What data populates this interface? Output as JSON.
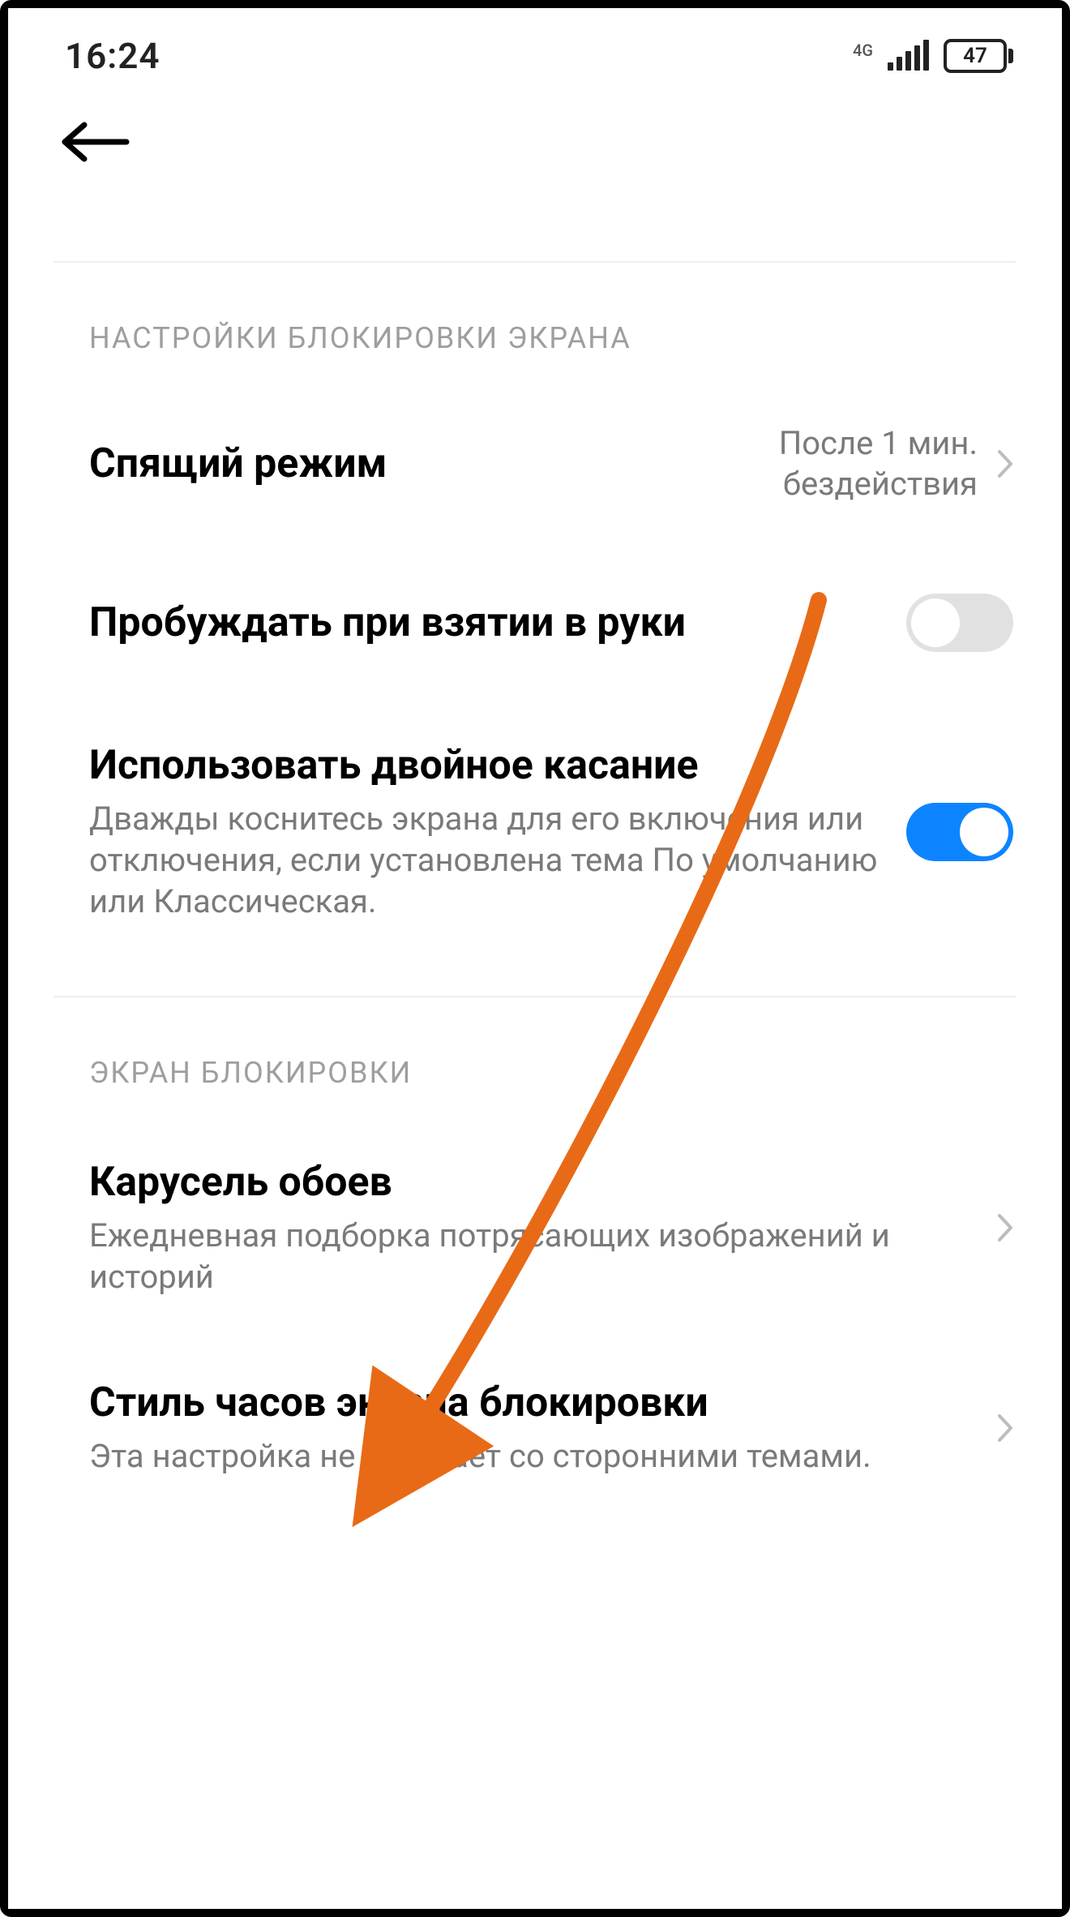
{
  "status": {
    "time": "16:24",
    "network_label": "4G",
    "battery_percent": "47"
  },
  "section1": {
    "header": "НАСТРОЙКИ БЛОКИРОВКИ ЭКРАНА",
    "sleep": {
      "title": "Спящий режим",
      "value_line1": "После 1 мин.",
      "value_line2": "бездействия"
    },
    "raise_to_wake": {
      "title": "Пробуждать при взятии в руки",
      "enabled": false
    },
    "double_tap": {
      "title": "Использовать двойное касание",
      "subtitle": "Дважды коснитесь экрана для его включения или отключения, если установлена тема По умолчанию или Классическая.",
      "enabled": true
    }
  },
  "section2": {
    "header": "ЭКРАН БЛОКИРОВКИ",
    "carousel": {
      "title": "Карусель обоев",
      "subtitle": "Ежедневная подборка потрясающих изображений и историй"
    },
    "clock_style": {
      "title": "Стиль часов экрана блокировки",
      "subtitle": "Эта настройка не работает со сторонними темами."
    }
  },
  "annotation": {
    "arrow_color": "#e86a16"
  }
}
